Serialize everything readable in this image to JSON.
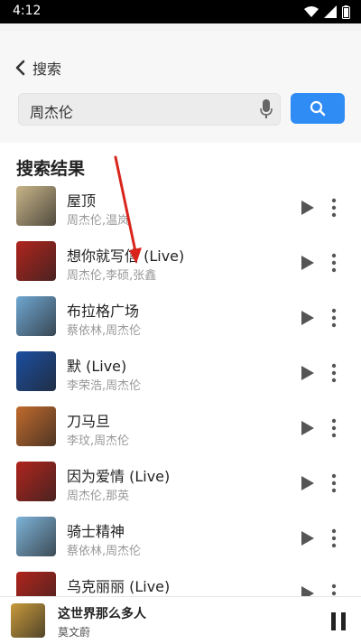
{
  "status": {
    "time": "4:12"
  },
  "header": {
    "back_label": "搜索",
    "search_value": "周杰伦"
  },
  "results": {
    "title": "搜索结果",
    "items": [
      {
        "title": "屋顶",
        "artist": "周杰伦,温岚",
        "cover_color": "#c8b488"
      },
      {
        "title": "想你就写信 (Live)",
        "artist": "周杰伦,李硕,张鑫",
        "cover_color": "#b0241d"
      },
      {
        "title": "布拉格广场",
        "artist": "蔡依林,周杰伦",
        "cover_color": "#6fa6d1"
      },
      {
        "title": "默 (Live)",
        "artist": "李荣浩,周杰伦",
        "cover_color": "#1b4ea0"
      },
      {
        "title": "刀马旦",
        "artist": "李玟,周杰伦",
        "cover_color": "#c06a2c"
      },
      {
        "title": "因为爱情 (Live)",
        "artist": "周杰伦,那英",
        "cover_color": "#b0241d"
      },
      {
        "title": "骑士精神",
        "artist": "蔡依林,周杰伦",
        "cover_color": "#7eb3d8"
      },
      {
        "title": "乌克丽丽 (Live)",
        "artist": "",
        "cover_color": "#b0241d"
      }
    ]
  },
  "player": {
    "title": "这世界那么多人",
    "artist": "莫文蔚",
    "cover_color": "#c89a3c"
  },
  "colors": {
    "accent": "#2f8cf5",
    "annotation_arrow": "#d9241c"
  }
}
